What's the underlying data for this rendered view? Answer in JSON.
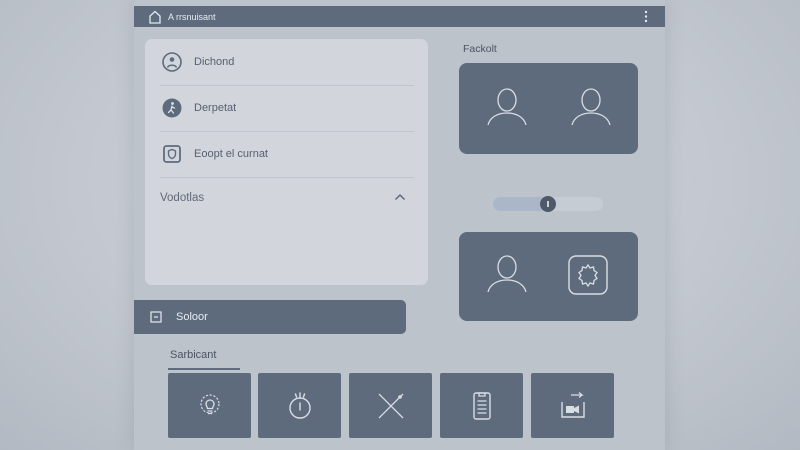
{
  "window": {
    "title": "A rrsnuisant"
  },
  "list": {
    "items": [
      {
        "label": "Dichond",
        "icon": "person-icon"
      },
      {
        "label": "Derpetat",
        "icon": "person-walk-icon"
      },
      {
        "label": "Eoopt el curnat",
        "icon": "shield-badge-icon"
      }
    ],
    "accordion_label": "Vodotlas"
  },
  "select_bar": {
    "label": "Soloor",
    "icon": "select-square-icon"
  },
  "section": {
    "title": "Sarbicant",
    "tiles": [
      {
        "icon": "lightbulb-gear-icon"
      },
      {
        "icon": "timer-icon"
      },
      {
        "icon": "cross-tool-icon"
      },
      {
        "icon": "clipboard-icon"
      },
      {
        "icon": "camera-export-icon"
      }
    ]
  },
  "right": {
    "label": "Fackolt"
  },
  "slider": {
    "value": 0.5
  },
  "colors": {
    "accent": "#5d6b7d",
    "panel": "#bdc3cb",
    "card": "#d2d6dc"
  }
}
